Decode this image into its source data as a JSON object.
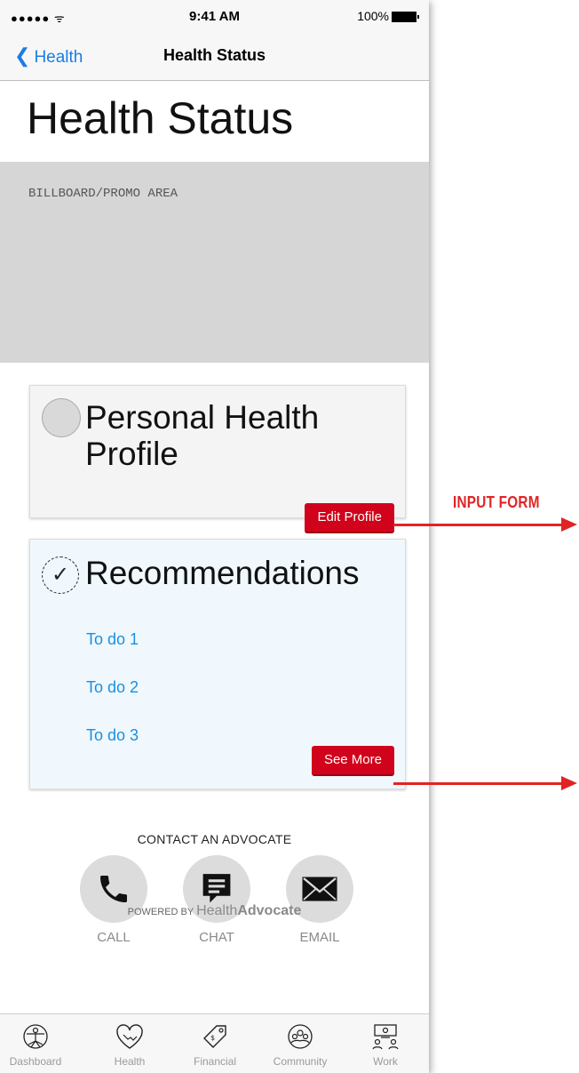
{
  "status_bar": {
    "signal": "●●●●● ᯤ",
    "time": "9:41 AM",
    "battery": "100%"
  },
  "nav": {
    "back_label": "Health",
    "title": "Health Status"
  },
  "page_title": "Health Status",
  "billboard": {
    "text": "BILLBOARD/PROMO AREA"
  },
  "profile_card": {
    "title": "Personal Health Profile",
    "button": "Edit Profile"
  },
  "recommendations_card": {
    "title": "Recommendations",
    "items": [
      "To do 1",
      "To do 2",
      "To do 3"
    ],
    "button": "See More"
  },
  "contact": {
    "label": "CONTACT AN ADVOCATE",
    "call": "CALL",
    "chat": "CHAT",
    "email": "EMAIL"
  },
  "powered": {
    "prefix": "POWERED BY",
    "brand_light": "Health",
    "brand_bold": "Advocate"
  },
  "tabs": [
    "Dashboard",
    "Health",
    "Financial",
    "Community",
    "Work"
  ],
  "annotation": {
    "text": "INPUT FORM",
    "color": "#e02424"
  },
  "colors": {
    "accent_red": "#d1021b",
    "link_blue": "#1a8fe0",
    "ios_blue": "#1a7ce6"
  }
}
